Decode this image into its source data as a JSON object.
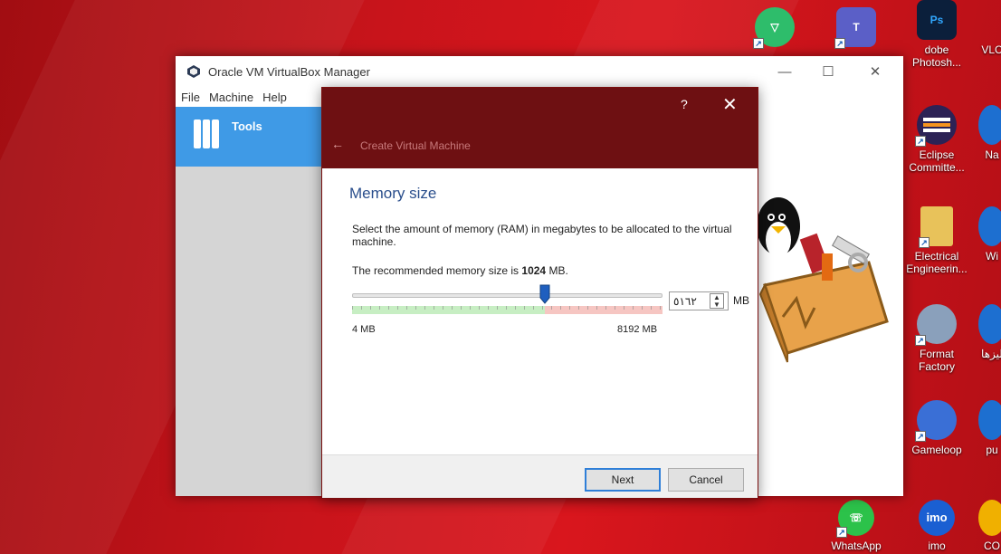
{
  "desktop": {
    "icons": [
      {
        "label": "dobe Photosh...",
        "glyph": "Ps",
        "color": "#2a8cf0"
      },
      {
        "label": "VLC",
        "glyph": "",
        "color": "#ff8800"
      },
      {
        "label": "Eclipse Committe...",
        "glyph": "",
        "color": "#2c2255"
      },
      {
        "label": "Na",
        "glyph": "",
        "color": "#1d6fd0"
      },
      {
        "label": "Electrical Engineerin...",
        "glyph": "",
        "color": "#e8c25a"
      },
      {
        "label": "Wi",
        "glyph": "",
        "color": "#1d6fd0"
      },
      {
        "label": "Format Factory",
        "glyph": "",
        "color": "#7a8da8"
      },
      {
        "label": "ليزها",
        "glyph": "",
        "color": "#1d6fd0"
      },
      {
        "label": "Gameloop",
        "glyph": "",
        "color": "#3a6fd6"
      },
      {
        "label": "pu",
        "glyph": "",
        "color": "#1d6fd0"
      },
      {
        "label": "WhatsApp",
        "glyph": "",
        "color": "#2cc24a"
      },
      {
        "label": "imo",
        "glyph": "imo",
        "color": "#1a5fd2"
      },
      {
        "label": "CO",
        "glyph": "",
        "color": "#f0b000"
      }
    ]
  },
  "vbox": {
    "title": "Oracle VM VirtualBox Manager",
    "menu": [
      "File",
      "Machine",
      "Help"
    ],
    "tools_label": "Tools",
    "minimize": "—",
    "maximize": "☐",
    "close": "✕"
  },
  "dialog": {
    "help": "?",
    "close": "✕",
    "back": "←",
    "title": "Create Virtual Machine",
    "heading": "Memory size",
    "description": "Select the amount of memory (RAM) in megabytes to be allocated to the virtual machine.",
    "recommended_prefix": "The recommended memory size is ",
    "recommended_value": "1024",
    "recommended_suffix": " MB.",
    "slider": {
      "min_label": "4 MB",
      "max_label": "8192 MB",
      "value_fraction": 0.62
    },
    "spin_value": "٥١٦٢",
    "unit": "MB",
    "next_label": "Next",
    "cancel_label": "Cancel"
  },
  "colors": {
    "dialog_header": "#6e1012",
    "tools_accent": "#3f9ae6",
    "heading_blue": "#2a4e8c",
    "slider_green": "#c7eec3",
    "slider_red": "#f6c6c2"
  }
}
